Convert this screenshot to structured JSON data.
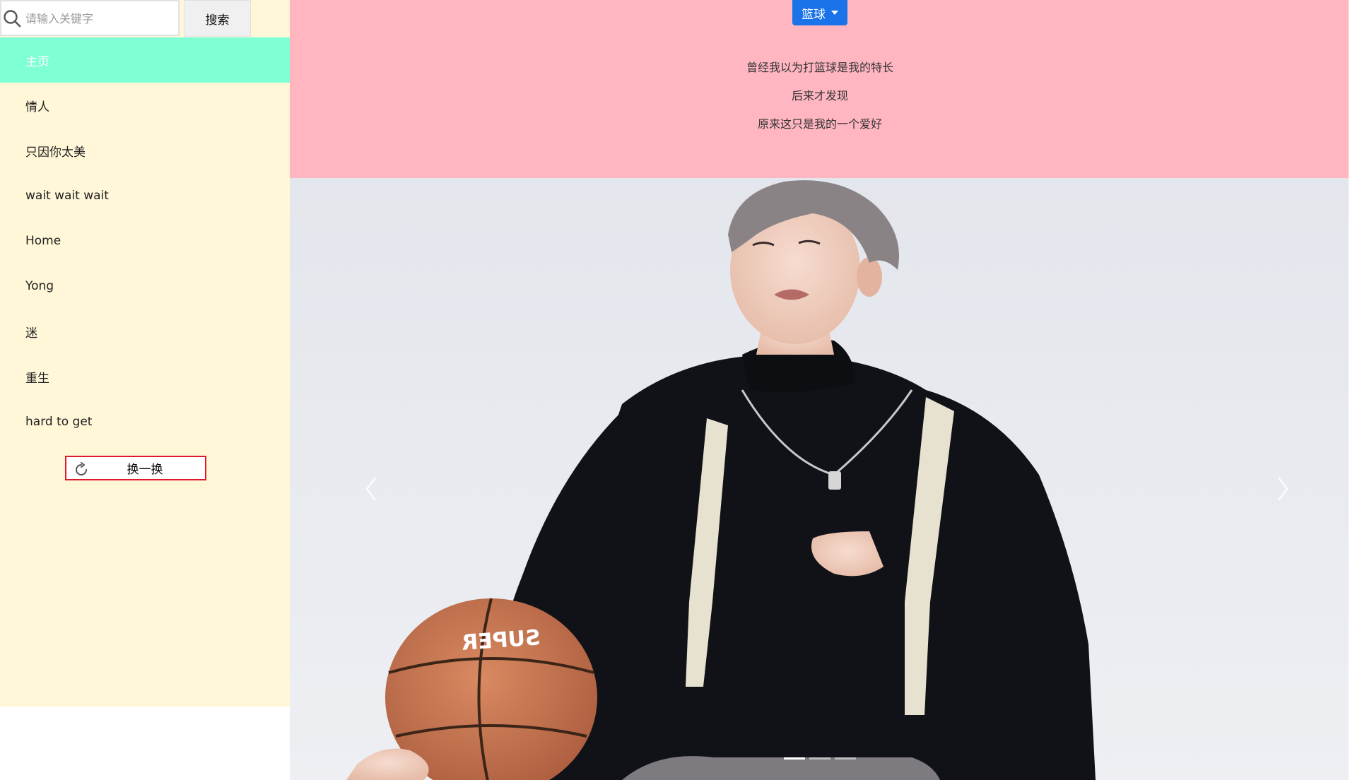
{
  "search": {
    "placeholder": "请输入关键字",
    "button_label": "搜索"
  },
  "sidebar": {
    "items": [
      {
        "label": "主页",
        "active": true
      },
      {
        "label": "情人",
        "active": false
      },
      {
        "label": "只因你太美",
        "active": false
      },
      {
        "label": "wait wait wait",
        "active": false
      },
      {
        "label": "Home",
        "active": false
      },
      {
        "label": "Yong",
        "active": false
      },
      {
        "label": "迷",
        "active": false
      },
      {
        "label": "重生",
        "active": false
      },
      {
        "label": "hard to get",
        "active": false
      }
    ],
    "swap_button_label": "换一换",
    "swap_icon": "refresh-icon"
  },
  "header": {
    "dropdown_label": "篮球",
    "lyrics": [
      "曾经我以为打篮球是我的特长",
      "后来才发现",
      "原来这只是我的一个爱好"
    ]
  },
  "carousel": {
    "prev_icon": "chevron-left-icon",
    "next_icon": "chevron-right-icon",
    "slide_count": 3,
    "active_slide": 1,
    "photo_content": "person in black turtleneck holding a basketball",
    "ball_text": "SUPER"
  },
  "colors": {
    "sidebar_bg": "#fff7d8",
    "nav_active_bg": "#7fffd4",
    "header_bg": "#ffb6c1",
    "dropdown_bg": "#1a73e8",
    "swap_border": "#e0182c"
  }
}
